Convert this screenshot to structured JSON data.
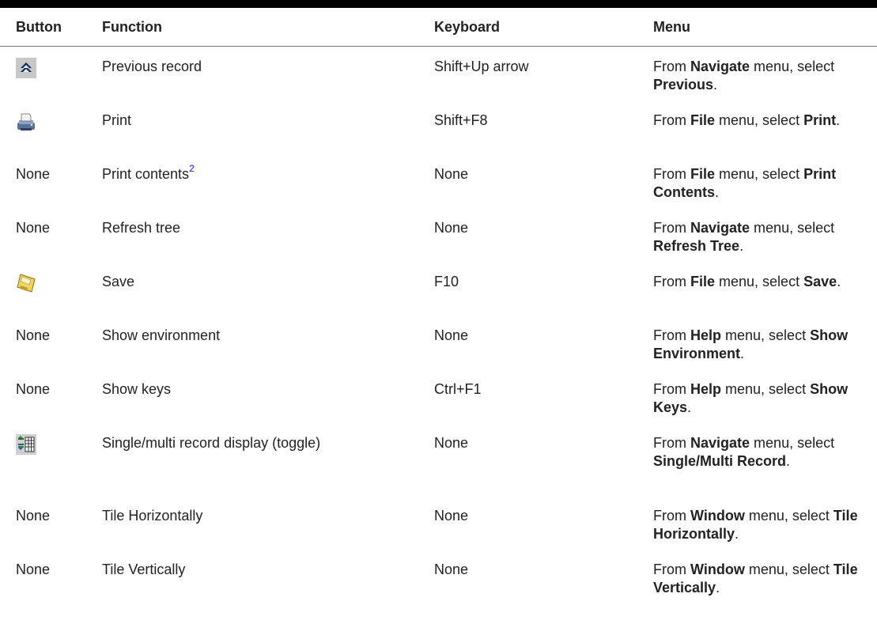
{
  "header": {
    "button": "Button",
    "function": "Function",
    "keyboard": "Keyboard",
    "menu": "Menu"
  },
  "rows": [
    {
      "button": "",
      "icon": "previous-record-icon",
      "function": "Previous record",
      "keyboard": "Shift+Up arrow",
      "menu": {
        "pre1": "From ",
        "b1": "Navigate",
        "mid": " menu, select ",
        "b2": "Previous",
        "post": "."
      }
    },
    {
      "button": "",
      "icon": "print-icon",
      "function": "Print",
      "keyboard": "Shift+F8",
      "menu": {
        "pre1": "From ",
        "b1": "File",
        "mid": " menu, select ",
        "b2": "Print",
        "post": "."
      }
    },
    {
      "button": "None",
      "function": "Print contents",
      "footnote": "2",
      "keyboard": "None",
      "menu": {
        "pre1": "From ",
        "b1": "File",
        "mid": " menu, select ",
        "b2": "Print Contents",
        "post": "."
      }
    },
    {
      "button": "None",
      "function": "Refresh tree",
      "keyboard": "None",
      "menu": {
        "pre1": "From ",
        "b1": "Navigate",
        "mid": " menu, select ",
        "b2": "Refresh Tree",
        "post": "."
      }
    },
    {
      "button": "",
      "icon": "save-icon",
      "function": "Save",
      "keyboard": "F10",
      "menu": {
        "pre1": "From ",
        "b1": "File",
        "mid": " menu, select ",
        "b2": "Save",
        "post": "."
      }
    },
    {
      "button": "None",
      "function": "Show environment",
      "keyboard": "None",
      "menu": {
        "pre1": "From ",
        "b1": "Help",
        "mid": " menu, select ",
        "b2": "Show Environment",
        "post": "."
      }
    },
    {
      "button": "None",
      "function": "Show keys",
      "keyboard": "Ctrl+F1",
      "menu": {
        "pre1": "From ",
        "b1": "Help",
        "mid": " menu, select ",
        "b2": "Show Keys",
        "post": "."
      }
    },
    {
      "button": "",
      "icon": "single-multi-record-icon",
      "function": "Single/multi record display (toggle)",
      "keyboard": "None",
      "menu": {
        "pre1": "From ",
        "b1": "Navigate",
        "mid": " menu, select ",
        "b2": "Single/Multi Record",
        "post": "."
      }
    },
    {
      "button": "None",
      "function": "Tile Horizontally",
      "keyboard": "None",
      "menu": {
        "pre1": "From ",
        "b1": "Window",
        "mid": " menu, select ",
        "b2": "Tile Horizontally",
        "post": "."
      }
    },
    {
      "button": "None",
      "function": "Tile Vertically",
      "keyboard": "None",
      "menu": {
        "pre1": "From ",
        "b1": "Window",
        "mid": " menu, select ",
        "b2": "Tile Vertically",
        "post": "."
      }
    }
  ]
}
